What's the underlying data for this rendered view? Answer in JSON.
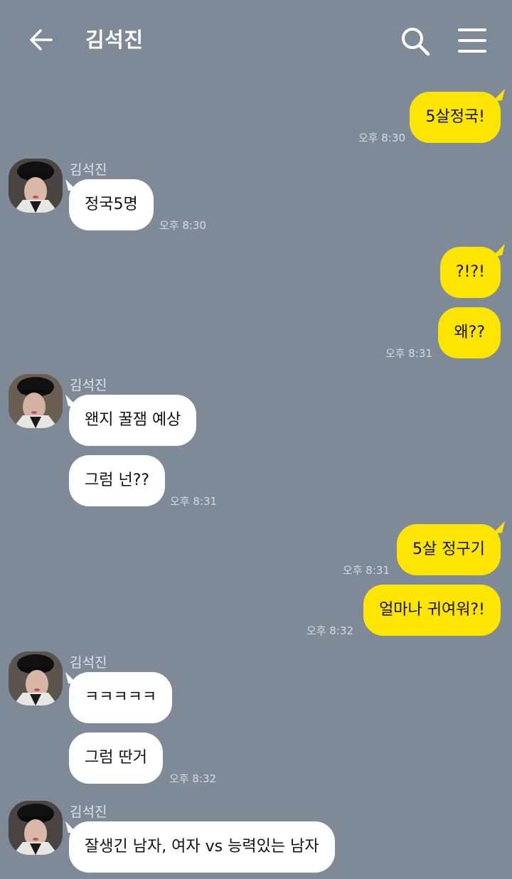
{
  "header": {
    "title": "김석진",
    "back_icon": "back-arrow-icon",
    "search_icon": "search-icon",
    "menu_icon": "hamburger-menu-icon"
  },
  "colors": {
    "background": "#7f8a99",
    "my_bubble": "#fee500",
    "their_bubble": "#ffffff"
  },
  "messages": [
    {
      "from": "me",
      "text": "5살정국!",
      "time": "오후 8:30"
    },
    {
      "from": "them",
      "sender": "김석진",
      "text": "정국5명",
      "time": "오후 8:30"
    },
    {
      "from": "me",
      "text": "?!?!",
      "time": ""
    },
    {
      "from": "me",
      "text": "왜??",
      "time": "오후 8:31"
    },
    {
      "from": "them",
      "sender": "김석진",
      "text": "왠지 꿀잼 예상",
      "time": ""
    },
    {
      "from": "them",
      "text": "그럼 넌??",
      "time": "오후 8:31"
    },
    {
      "from": "me",
      "text": "5살 정구기",
      "time": "오후 8:31"
    },
    {
      "from": "me",
      "text": "얼마나 귀여워?!",
      "time": "오후 8:32"
    },
    {
      "from": "them",
      "sender": "김석진",
      "text": "ㅋㅋㅋㅋㅋ",
      "time": ""
    },
    {
      "from": "them",
      "text": "그럼 딴거",
      "time": "오후 8:32"
    },
    {
      "from": "them",
      "sender": "김석진",
      "text": "잘생긴 남자, 여자 vs 능력있는 남자",
      "time": ""
    }
  ]
}
